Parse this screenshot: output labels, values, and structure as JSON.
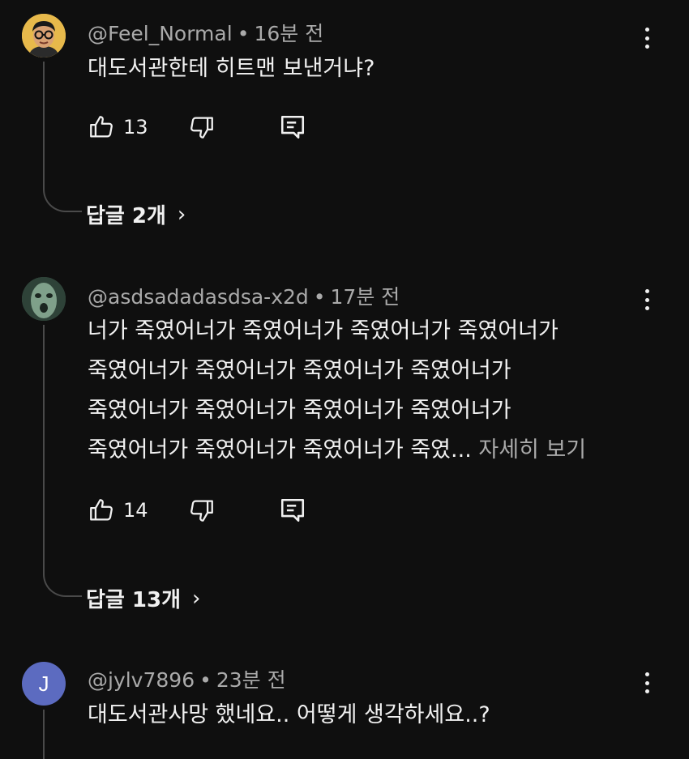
{
  "comments": [
    {
      "handle": "@Feel_Normal",
      "time": "16분 전",
      "avatar": {
        "type": "person-glasses",
        "bg": "#e7b94b"
      },
      "lines": [
        "대도서관한테 히트맨 보낸거냐?"
      ],
      "more": "",
      "likes": "13",
      "replies_label": "답글 2개"
    },
    {
      "handle": "@asdsadadasdsa-x2d",
      "time": "17분 전",
      "avatar": {
        "type": "green-face",
        "bg": "#3d5a4e"
      },
      "lines": [
        "너가 죽였어너가 죽였어너가 죽였어너가 죽였어너가",
        "죽였어너가 죽였어너가 죽였어너가 죽였어너가",
        "죽였어너가 죽였어너가 죽였어너가 죽였어너가",
        "죽였어너가 죽였어너가 죽였어너가 죽였..."
      ],
      "more": " 자세히 보기",
      "likes": "14",
      "replies_label": "답글 13개"
    },
    {
      "handle": "@jylv7896",
      "time": "23분 전",
      "avatar": {
        "type": "letter",
        "letter": "J",
        "bg": "#5c6bc0"
      },
      "lines": [
        "대도서관사망 했네요.. 어떻게 생각하세요..?"
      ],
      "more": "",
      "likes": "",
      "replies_label": ""
    }
  ],
  "icons": {
    "like": "thumbs-up-icon",
    "dislike": "thumbs-down-icon",
    "reply": "reply-comment-icon",
    "menu": "more-vertical-icon",
    "chevron": "chevron-right-icon"
  },
  "colors": {
    "background": "#0f0f0f",
    "primary_text": "#f1f1f1",
    "secondary_text": "#aaaaaa",
    "thread_line": "#4a4a4a"
  }
}
